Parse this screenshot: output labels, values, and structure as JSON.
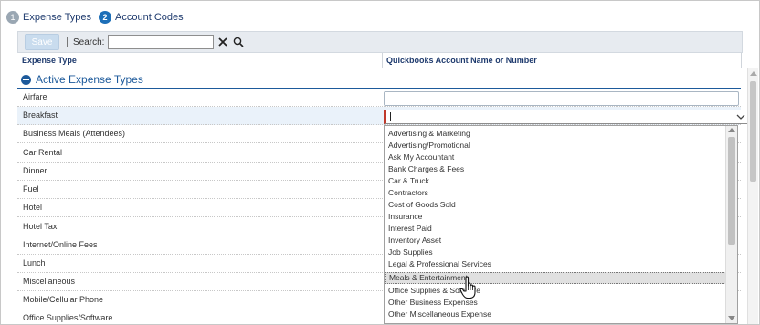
{
  "steps": [
    {
      "num": "1",
      "label": "Expense Types",
      "active": false
    },
    {
      "num": "2",
      "label": "Account Codes",
      "active": true
    }
  ],
  "toolbar": {
    "save_label": "Save",
    "search_label": "Search:",
    "search_value": "",
    "clear_icon": "close-icon",
    "search_icon": "search-icon"
  },
  "table": {
    "col_expense_type": "Expense Type",
    "col_account": "Quickbooks Account Name or Number",
    "group_label": "Active Expense Types",
    "rows": [
      "Airfare",
      "Breakfast",
      "Business Meals (Attendees)",
      "Car Rental",
      "Dinner",
      "Fuel",
      "Hotel",
      "Hotel Tax",
      "Internet/Online Fees",
      "Lunch",
      "Miscellaneous",
      "Mobile/Cellular Phone",
      "Office Supplies/Software"
    ]
  },
  "account_combo": {
    "value": "",
    "options": [
      "Advertising & Marketing",
      "Advertising/Promotional",
      "Ask My Accountant",
      "Bank Charges & Fees",
      "Car & Truck",
      "Contractors",
      "Cost of Goods Sold",
      "Insurance",
      "Interest Paid",
      "Inventory Asset",
      "Job Supplies",
      "Legal & Professional Services",
      "Meals & Entertainment",
      "Office Supplies & Software",
      "Other Business Expenses",
      "Other Miscellaneous Expense"
    ],
    "hovered_option": "Meals & Entertainment"
  },
  "colors": {
    "accent": "#1d6fb8",
    "group": "#1d5a9b",
    "required": "#c0392b"
  }
}
